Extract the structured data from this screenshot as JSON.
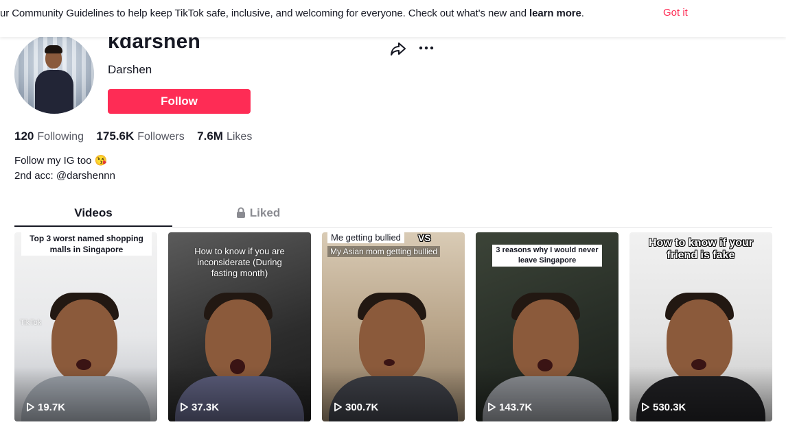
{
  "banner": {
    "text": "ur Community Guidelines to help keep TikTok safe, inclusive, and welcoming for everyone. Check out what's new and ",
    "link": "learn more",
    "period": ".",
    "dismiss_label": "Got it"
  },
  "profile": {
    "username": "kdarshen",
    "display_name": "Darshen",
    "follow_label": "Follow",
    "stats": {
      "following_count": "120",
      "following_label": "Following",
      "followers_count": "175.6K",
      "followers_label": "Followers",
      "likes_count": "7.6M",
      "likes_label": "Likes"
    },
    "bio_line1": "Follow my IG too 😘",
    "bio_line2": "2nd acc: @darshennn"
  },
  "tabs": {
    "videos": "Videos",
    "liked": "Liked"
  },
  "videos": [
    {
      "caption": "Top 3 worst named shopping malls in Singapore",
      "views": "19.7K",
      "watermark": "TikTok"
    },
    {
      "caption": "How to know if you are inconsiderate (During fasting month)",
      "views": "37.3K"
    },
    {
      "caption_a": "Me getting bullied",
      "caption_vs": "VS",
      "caption_b": "My Asian mom getting bullied",
      "views": "300.7K"
    },
    {
      "caption": "3 reasons why I would never leave Singapore",
      "views": "143.7K"
    },
    {
      "caption": "How to know if your friend is fake",
      "views": "530.3K"
    }
  ],
  "colors": {
    "accent": "#fe2c55",
    "text": "#161823",
    "muted": "#8a8b91"
  },
  "icons": [
    "share-icon",
    "more-icon",
    "lock-icon",
    "play-icon"
  ]
}
